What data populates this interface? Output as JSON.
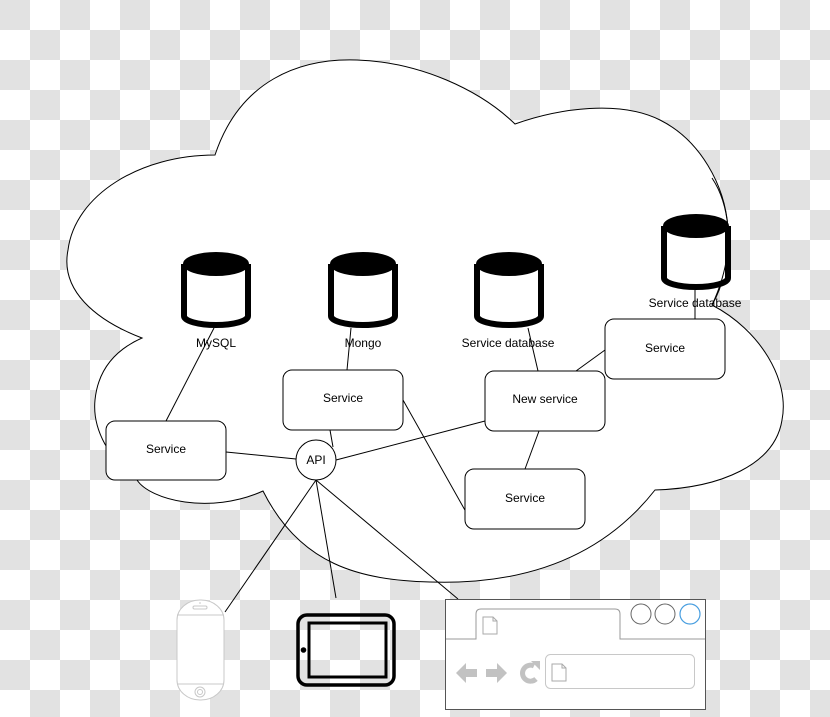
{
  "diagram": {
    "title": "",
    "databases": [
      {
        "id": "db_mysql",
        "label": "MySQL"
      },
      {
        "id": "db_mongo",
        "label": "Mongo"
      },
      {
        "id": "db_service",
        "label": "Service database"
      },
      {
        "id": "db_service2",
        "label": "Service database"
      }
    ],
    "services": [
      {
        "id": "svc_left",
        "label": "Service"
      },
      {
        "id": "svc_mongo",
        "label": "Service"
      },
      {
        "id": "svc_new",
        "label": "New service"
      },
      {
        "id": "svc_right",
        "label": "Service"
      },
      {
        "id": "svc_lower",
        "label": "Service"
      }
    ],
    "gateway": {
      "id": "api",
      "label": "API"
    },
    "clients": [
      {
        "id": "phone",
        "icon": "smartphone-icon"
      },
      {
        "id": "tablet",
        "icon": "tablet-icon"
      },
      {
        "id": "browser",
        "icon": "browser-window-icon"
      }
    ],
    "edges": [
      {
        "from": "db_mysql",
        "to": "svc_left"
      },
      {
        "from": "db_mongo",
        "to": "svc_mongo"
      },
      {
        "from": "db_service",
        "to": "svc_new"
      },
      {
        "from": "db_service2",
        "to": "svc_right"
      },
      {
        "from": "svc_right",
        "to": "svc_new"
      },
      {
        "from": "svc_new",
        "to": "svc_lower"
      },
      {
        "from": "svc_mongo",
        "to": "svc_lower"
      },
      {
        "from": "api",
        "to": "svc_left"
      },
      {
        "from": "api",
        "to": "svc_mongo"
      },
      {
        "from": "api",
        "to": "svc_new"
      },
      {
        "from": "api",
        "to": "phone"
      },
      {
        "from": "api",
        "to": "tablet"
      },
      {
        "from": "api",
        "to": "browser"
      }
    ],
    "container": {
      "shape": "cloud",
      "label": ""
    },
    "colors": {
      "stroke": "#000000",
      "fill": "#ffffff",
      "checker": "#e2e2e2",
      "device_gray": "#c8c8c8",
      "browser_accent": "#4a9fe0"
    }
  }
}
